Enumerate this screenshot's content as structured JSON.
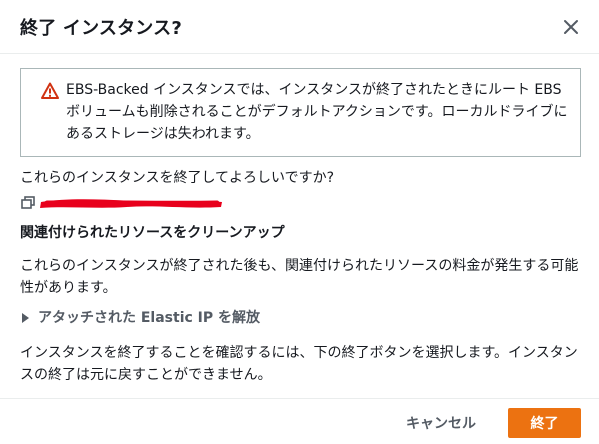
{
  "dialog": {
    "title": "終了 インスタンス?",
    "close_icon": "close-icon"
  },
  "alert": {
    "icon": "warning-icon",
    "icon_color": "#d13212",
    "message": "EBS-Backed インスタンスでは、インスタンスが終了されたときにルート EBS ボリュームも削除されることがデフォルトアクションです。ローカルドライブにあるストレージは失われます。"
  },
  "question": "これらのインスタンスを終了してよろしいですか?",
  "instance": {
    "icon": "instance-copy-icon",
    "redaction_color": "#e8001c"
  },
  "associated": {
    "heading": "関連付けられたリソースをクリーンアップ",
    "description": "これらのインスタンスが終了された後も、関連付けられたリソースの料金が発生する可能性があります。"
  },
  "expander": {
    "label": "アタッチされた Elastic IP を解放",
    "icon": "caret-right-icon"
  },
  "confirm_text": "インスタンスを終了することを確認するには、下の終了ボタンを選択します。インスタンスの終了は元に戻すことができません。",
  "footer": {
    "cancel_label": "キャンセル",
    "confirm_label": "終了",
    "primary_color": "#ec7211"
  }
}
